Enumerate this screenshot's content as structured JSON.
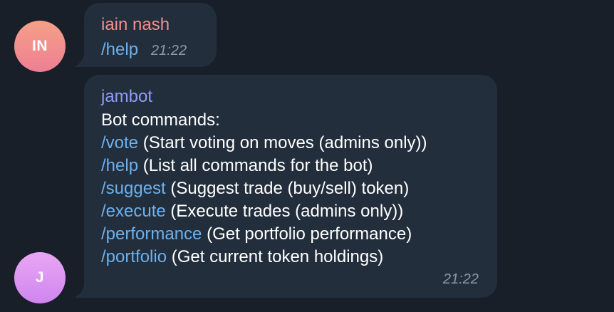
{
  "messages": [
    {
      "avatar_initials": "IN",
      "sender": "iain nash",
      "text": "/help",
      "time": "21:22"
    },
    {
      "avatar_initials": "J",
      "sender": "jambot",
      "intro": "Bot commands:",
      "commands": [
        {
          "command": "/vote",
          "description": " (Start voting on moves (admins only))"
        },
        {
          "command": "/help",
          "description": " (List all commands for the bot)"
        },
        {
          "command": "/suggest",
          "description": " (Suggest trade (buy/sell) token)"
        },
        {
          "command": "/execute",
          "description": " (Execute trades (admins only))"
        },
        {
          "command": "/performance",
          "description": " (Get portfolio performance)"
        },
        {
          "command": "/portfolio",
          "description": " (Get current token holdings)"
        }
      ],
      "time": "21:22"
    }
  ],
  "colors": {
    "background": "#181f28",
    "bubble": "#232e3c",
    "link": "#6bb1ef",
    "sender_iain": "#f28f8f",
    "sender_jambot": "#8f9cf5",
    "time": "#8d98a6"
  }
}
